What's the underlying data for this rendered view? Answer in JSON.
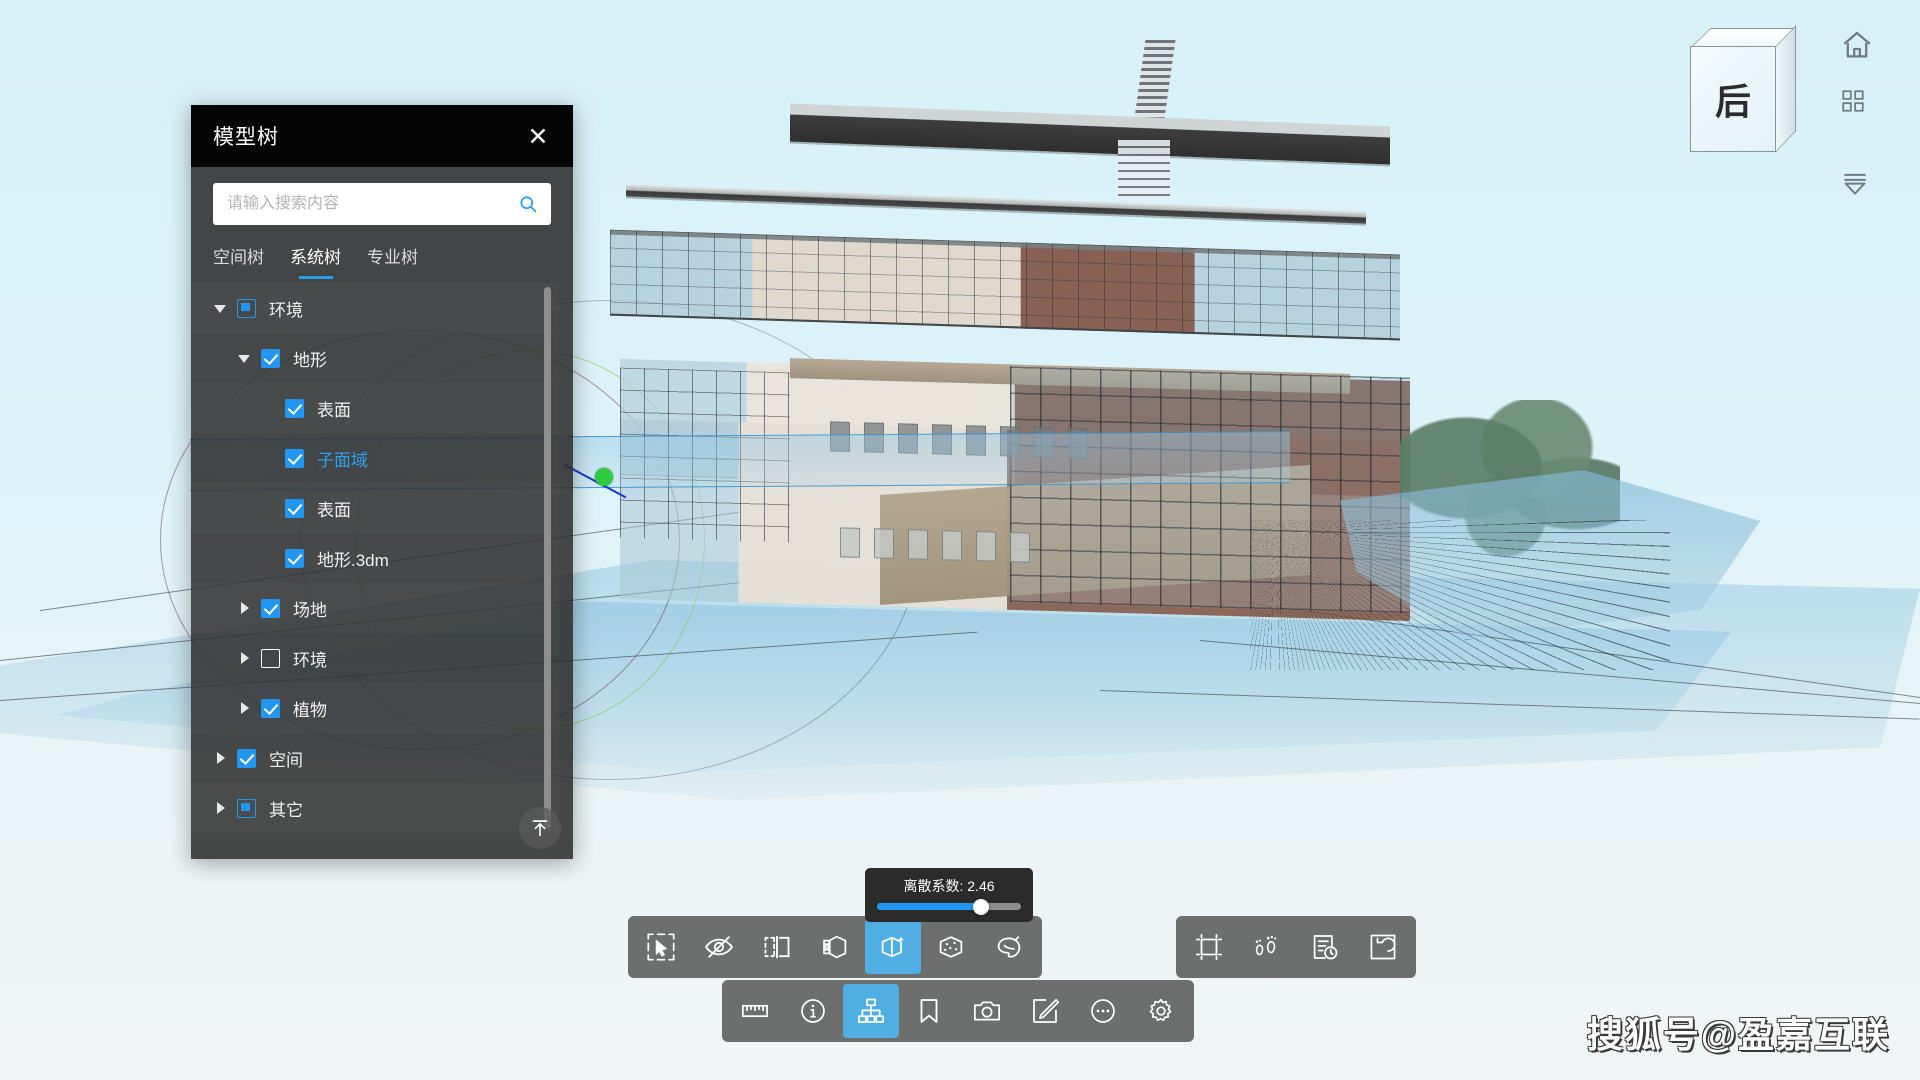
{
  "app": {
    "background_color": "#ddf3fa",
    "accent_color": "#2196f3"
  },
  "panel": {
    "title": "模型树",
    "close_label": "✕",
    "search": {
      "placeholder": "请输入搜索内容",
      "value": "",
      "icon": "search-icon"
    },
    "tabs": [
      {
        "label": "空间树",
        "active": false
      },
      {
        "label": "系统树",
        "active": true
      },
      {
        "label": "专业树",
        "active": false
      }
    ],
    "tree": [
      {
        "label": "环境",
        "depth": 0,
        "caret": "expanded",
        "check": "partial",
        "selected": false
      },
      {
        "label": "地形",
        "depth": 1,
        "caret": "expanded",
        "check": "checked",
        "selected": false
      },
      {
        "label": "表面",
        "depth": 2,
        "caret": "none",
        "check": "checked",
        "selected": false
      },
      {
        "label": "子面域",
        "depth": 2,
        "caret": "none",
        "check": "checked",
        "selected": true
      },
      {
        "label": "表面",
        "depth": 2,
        "caret": "none",
        "check": "checked",
        "selected": false
      },
      {
        "label": "地形.3dm",
        "depth": 2,
        "caret": "none",
        "check": "checked",
        "selected": false
      },
      {
        "label": "场地",
        "depth": 1,
        "caret": "collapsed",
        "check": "checked",
        "selected": false
      },
      {
        "label": "环境",
        "depth": 1,
        "caret": "collapsed",
        "check": "unchecked",
        "selected": false
      },
      {
        "label": "植物",
        "depth": 1,
        "caret": "collapsed",
        "check": "checked",
        "selected": false
      },
      {
        "label": "空间",
        "depth": 0,
        "caret": "collapsed",
        "check": "checked",
        "selected": false
      },
      {
        "label": "其它",
        "depth": 0,
        "caret": "collapsed",
        "check": "partial",
        "selected": false
      }
    ],
    "scrollbar": {
      "thumb_percent": 100
    },
    "to_top_button": "scroll-to-top-icon"
  },
  "viewcube": {
    "face_label": "后",
    "nav_icons": [
      {
        "name": "home-icon"
      },
      {
        "name": "grid-view-icon"
      },
      {
        "name": "collapse-down-icon"
      }
    ]
  },
  "slider": {
    "label": "离散系数: 2.46",
    "value": 2.46,
    "min": 0,
    "max": 3.4,
    "fill_percent": 72
  },
  "toolbars": {
    "primary": [
      {
        "name": "box-select-icon",
        "active": false
      },
      {
        "name": "hide-eye-icon",
        "active": false
      },
      {
        "name": "section-box-icon",
        "active": false
      },
      {
        "name": "open-box-icon",
        "active": false
      },
      {
        "name": "explode-box-icon",
        "active": true
      },
      {
        "name": "scatter-box-icon",
        "active": false
      },
      {
        "name": "palette-icon",
        "active": false
      }
    ],
    "secondary": [
      {
        "name": "ruler-measure-icon",
        "active": false
      },
      {
        "name": "info-circle-icon",
        "active": false
      },
      {
        "name": "model-tree-icon",
        "active": true
      },
      {
        "name": "bookmark-icon",
        "active": false
      },
      {
        "name": "camera-icon",
        "active": false
      },
      {
        "name": "edit-note-icon",
        "active": false
      },
      {
        "name": "more-dots-icon",
        "active": false
      },
      {
        "name": "settings-gear-icon",
        "active": false
      }
    ],
    "right": [
      {
        "name": "crop-frame-icon",
        "active": false
      },
      {
        "name": "walkthrough-feet-icon",
        "active": false
      },
      {
        "name": "schedule-clock-icon",
        "active": false
      },
      {
        "name": "reset-rotate-icon",
        "active": false
      }
    ]
  },
  "watermark": {
    "text": "搜狐号@盈嘉互联"
  }
}
